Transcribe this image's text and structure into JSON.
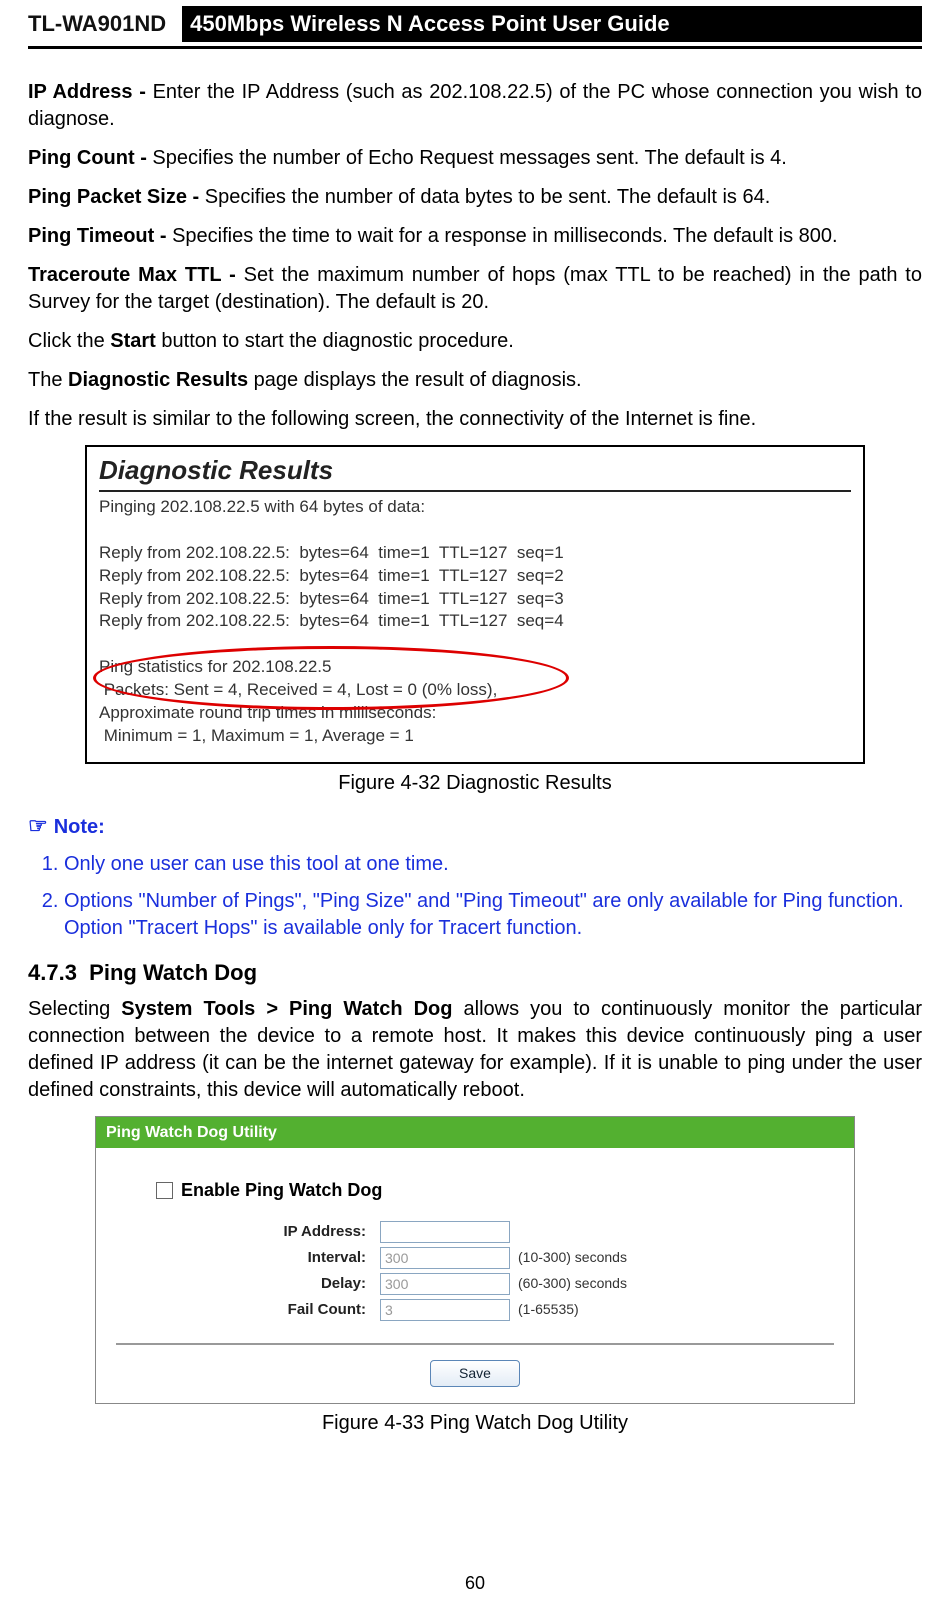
{
  "header": {
    "model": "TL-WA901ND",
    "title": "450Mbps Wireless N Access Point User Guide"
  },
  "paras": {
    "ip_label": "IP Address - ",
    "ip_text": "Enter the IP Address (such as 202.108.22.5) of the PC whose connection you wish to diagnose.",
    "pc_label": "Ping Count - ",
    "pc_text": "Specifies the number of Echo Request messages sent. The default is 4.",
    "pps_label": "Ping Packet Size - ",
    "pps_text": "Specifies the number of data bytes to be sent. The default is 64.",
    "pt_label": "Ping Timeout - ",
    "pt_text": "Specifies the time to wait for a response in milliseconds. The default is 800.",
    "ttl_label": "Traceroute Max TTL - ",
    "ttl_text": "Set the maximum number of hops (max TTL to be reached) in the path to Survey for the target (destination). The default is 20.",
    "start_pre": "Click the ",
    "start_bold": "Start",
    "start_post": " button to start the diagnostic procedure.",
    "dr_pre": "The ",
    "dr_bold": "Diagnostic Results",
    "dr_post": " page displays the result of diagnosis.",
    "res_similar": "If the result is similar to the following screen, the connectivity of the Internet is fine."
  },
  "diag": {
    "title": "Diagnostic Results",
    "body": "Pinging 202.108.22.5 with 64 bytes of data:\n\nReply from 202.108.22.5:  bytes=64  time=1  TTL=127  seq=1\nReply from 202.108.22.5:  bytes=64  time=1  TTL=127  seq=2\nReply from 202.108.22.5:  bytes=64  time=1  TTL=127  seq=3\nReply from 202.108.22.5:  bytes=64  time=1  TTL=127  seq=4\n\nPing statistics for 202.108.22.5\n Packets: Sent = 4, Received = 4, Lost = 0 (0% loss),\nApproximate round trip times in milliseconds:\n Minimum = 1, Maximum = 1, Average = 1",
    "caption": "Figure 4-32    Diagnostic Results"
  },
  "note": {
    "head": "Note:",
    "items": [
      "Only one user can use this tool at one time.",
      "Options \"Number of Pings\", \"Ping Size\" and \"Ping Timeout\" are only available for Ping function. Option \"Tracert Hops\" is available only for Tracert function."
    ]
  },
  "sec473": {
    "num": "4.7.3",
    "title": "Ping Watch Dog",
    "pre": "Selecting ",
    "bold": "System Tools > Ping Watch Dog",
    "post": " allows you to continuously monitor the particular connection between the device to a remote host. It makes this device continuously ping a user defined IP address (it can be the internet gateway for example). If it is unable to ping under the user defined constraints, this device will automatically reboot."
  },
  "pwd": {
    "bar": "Ping Watch Dog Utility",
    "enable": "Enable Ping Watch Dog",
    "rows": {
      "ip_label": "IP Address:",
      "ip_value": "",
      "int_label": "Interval:",
      "int_value": "300",
      "int_hint": "(10-300) seconds",
      "del_label": "Delay:",
      "del_value": "300",
      "del_hint": "(60-300) seconds",
      "fc_label": "Fail Count:",
      "fc_value": "3",
      "fc_hint": "(1-65535)"
    },
    "save": "Save",
    "caption": "Figure 4-33 Ping Watch Dog Utility"
  },
  "page_number": "60"
}
